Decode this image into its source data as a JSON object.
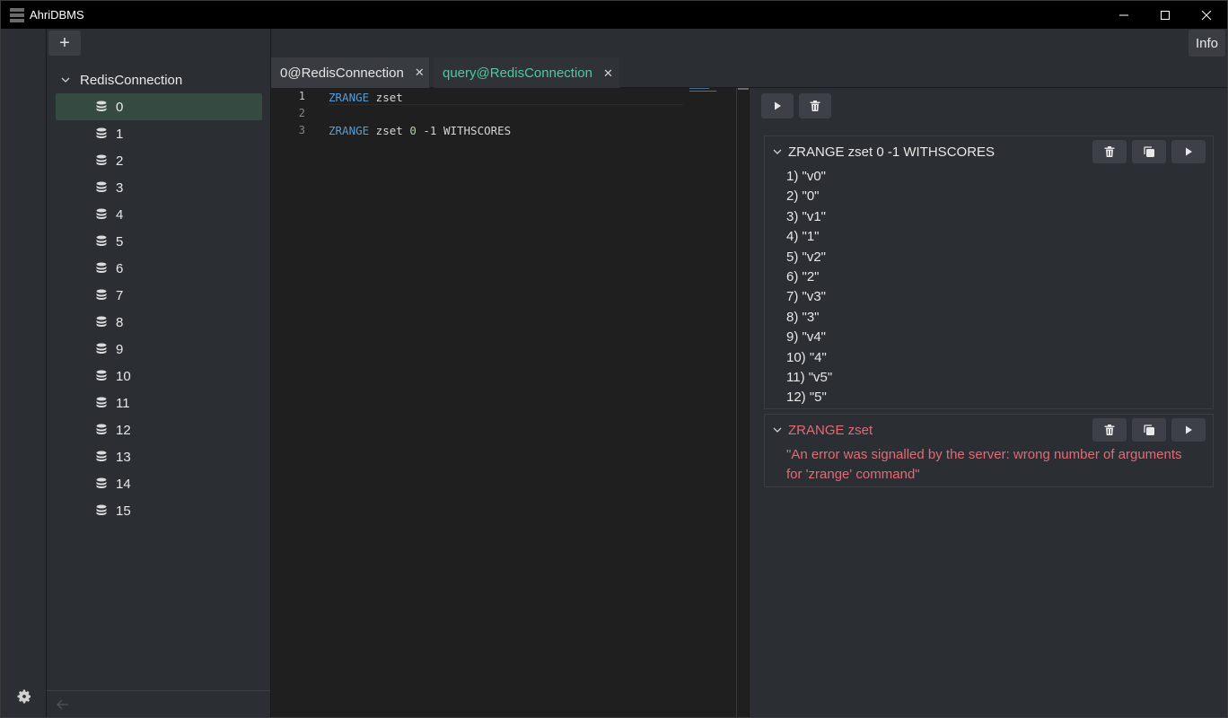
{
  "window": {
    "title": "AhriDBMS",
    "controls": {
      "minimize": "—",
      "maximize": "☐",
      "close": "✕"
    }
  },
  "sidebar": {
    "add_label": "+",
    "connection": {
      "label": "RedisConnection",
      "expanded": true
    },
    "databases": [
      {
        "label": "0",
        "selected": true
      },
      {
        "label": "1"
      },
      {
        "label": "2"
      },
      {
        "label": "3"
      },
      {
        "label": "4"
      },
      {
        "label": "5"
      },
      {
        "label": "6"
      },
      {
        "label": "7"
      },
      {
        "label": "8"
      },
      {
        "label": "9"
      },
      {
        "label": "10"
      },
      {
        "label": "11"
      },
      {
        "label": "12"
      },
      {
        "label": "13"
      },
      {
        "label": "14"
      },
      {
        "label": "15"
      }
    ]
  },
  "header": {
    "info_label": "Info"
  },
  "tabs": [
    {
      "label": "0@RedisConnection",
      "close": "✕",
      "active": false
    },
    {
      "label": "query@RedisConnection",
      "close": "✕",
      "active": true
    }
  ],
  "editor": {
    "lines": [
      {
        "number": "1",
        "tokens": [
          {
            "t": "ZRANGE",
            "c": "kw"
          },
          {
            "t": " zset",
            "c": ""
          }
        ]
      },
      {
        "number": "2",
        "tokens": []
      },
      {
        "number": "3",
        "tokens": [
          {
            "t": "ZRANGE",
            "c": "kw"
          },
          {
            "t": " zset ",
            "c": ""
          },
          {
            "t": "0",
            "c": "num"
          },
          {
            "t": " -1 WITHSCORES",
            "c": ""
          }
        ]
      }
    ]
  },
  "results": {
    "cards": [
      {
        "title": "ZRANGE zset 0 -1 WITHSCORES",
        "error": false,
        "lines": [
          "1) \"v0\"",
          "2) \"0\"",
          "3) \"v1\"",
          "4) \"1\"",
          "5) \"v2\"",
          "6) \"2\"",
          "7) \"v3\"",
          "8) \"3\"",
          "9) \"v4\"",
          "10) \"4\"",
          "11) \"v5\"",
          "12) \"5\""
        ]
      },
      {
        "title": "ZRANGE zset",
        "error": true,
        "message": "\"An error was signalled by the server: wrong number of arguments for 'zrange' command\""
      }
    ]
  },
  "colors": {
    "accent": "#4ec9a0",
    "error": "#e06c75",
    "keyword": "#569cd6",
    "selection": "#354a41"
  }
}
